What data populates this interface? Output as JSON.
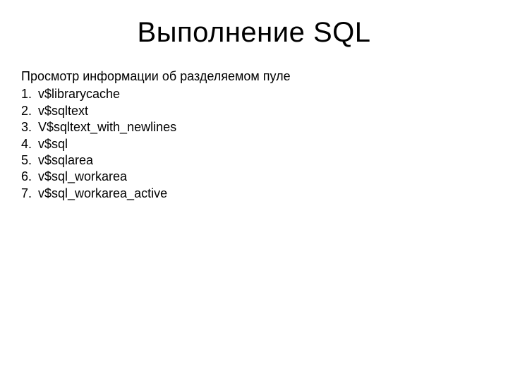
{
  "title": "Выполнение SQL",
  "intro": "Просмотр информации об разделяемом пуле",
  "items": [
    {
      "num": "1.",
      "text": "v$librarycache"
    },
    {
      "num": "2.",
      "text": "v$sqltext"
    },
    {
      "num": "3.",
      "text": "V$sqltext_with_newlines"
    },
    {
      "num": "4.",
      "text": "v$sql"
    },
    {
      "num": "5.",
      "text": "v$sqlarea"
    },
    {
      "num": "6.",
      "text": "v$sql_workarea"
    },
    {
      "num": "7.",
      "text": "v$sql_workarea_active"
    }
  ]
}
